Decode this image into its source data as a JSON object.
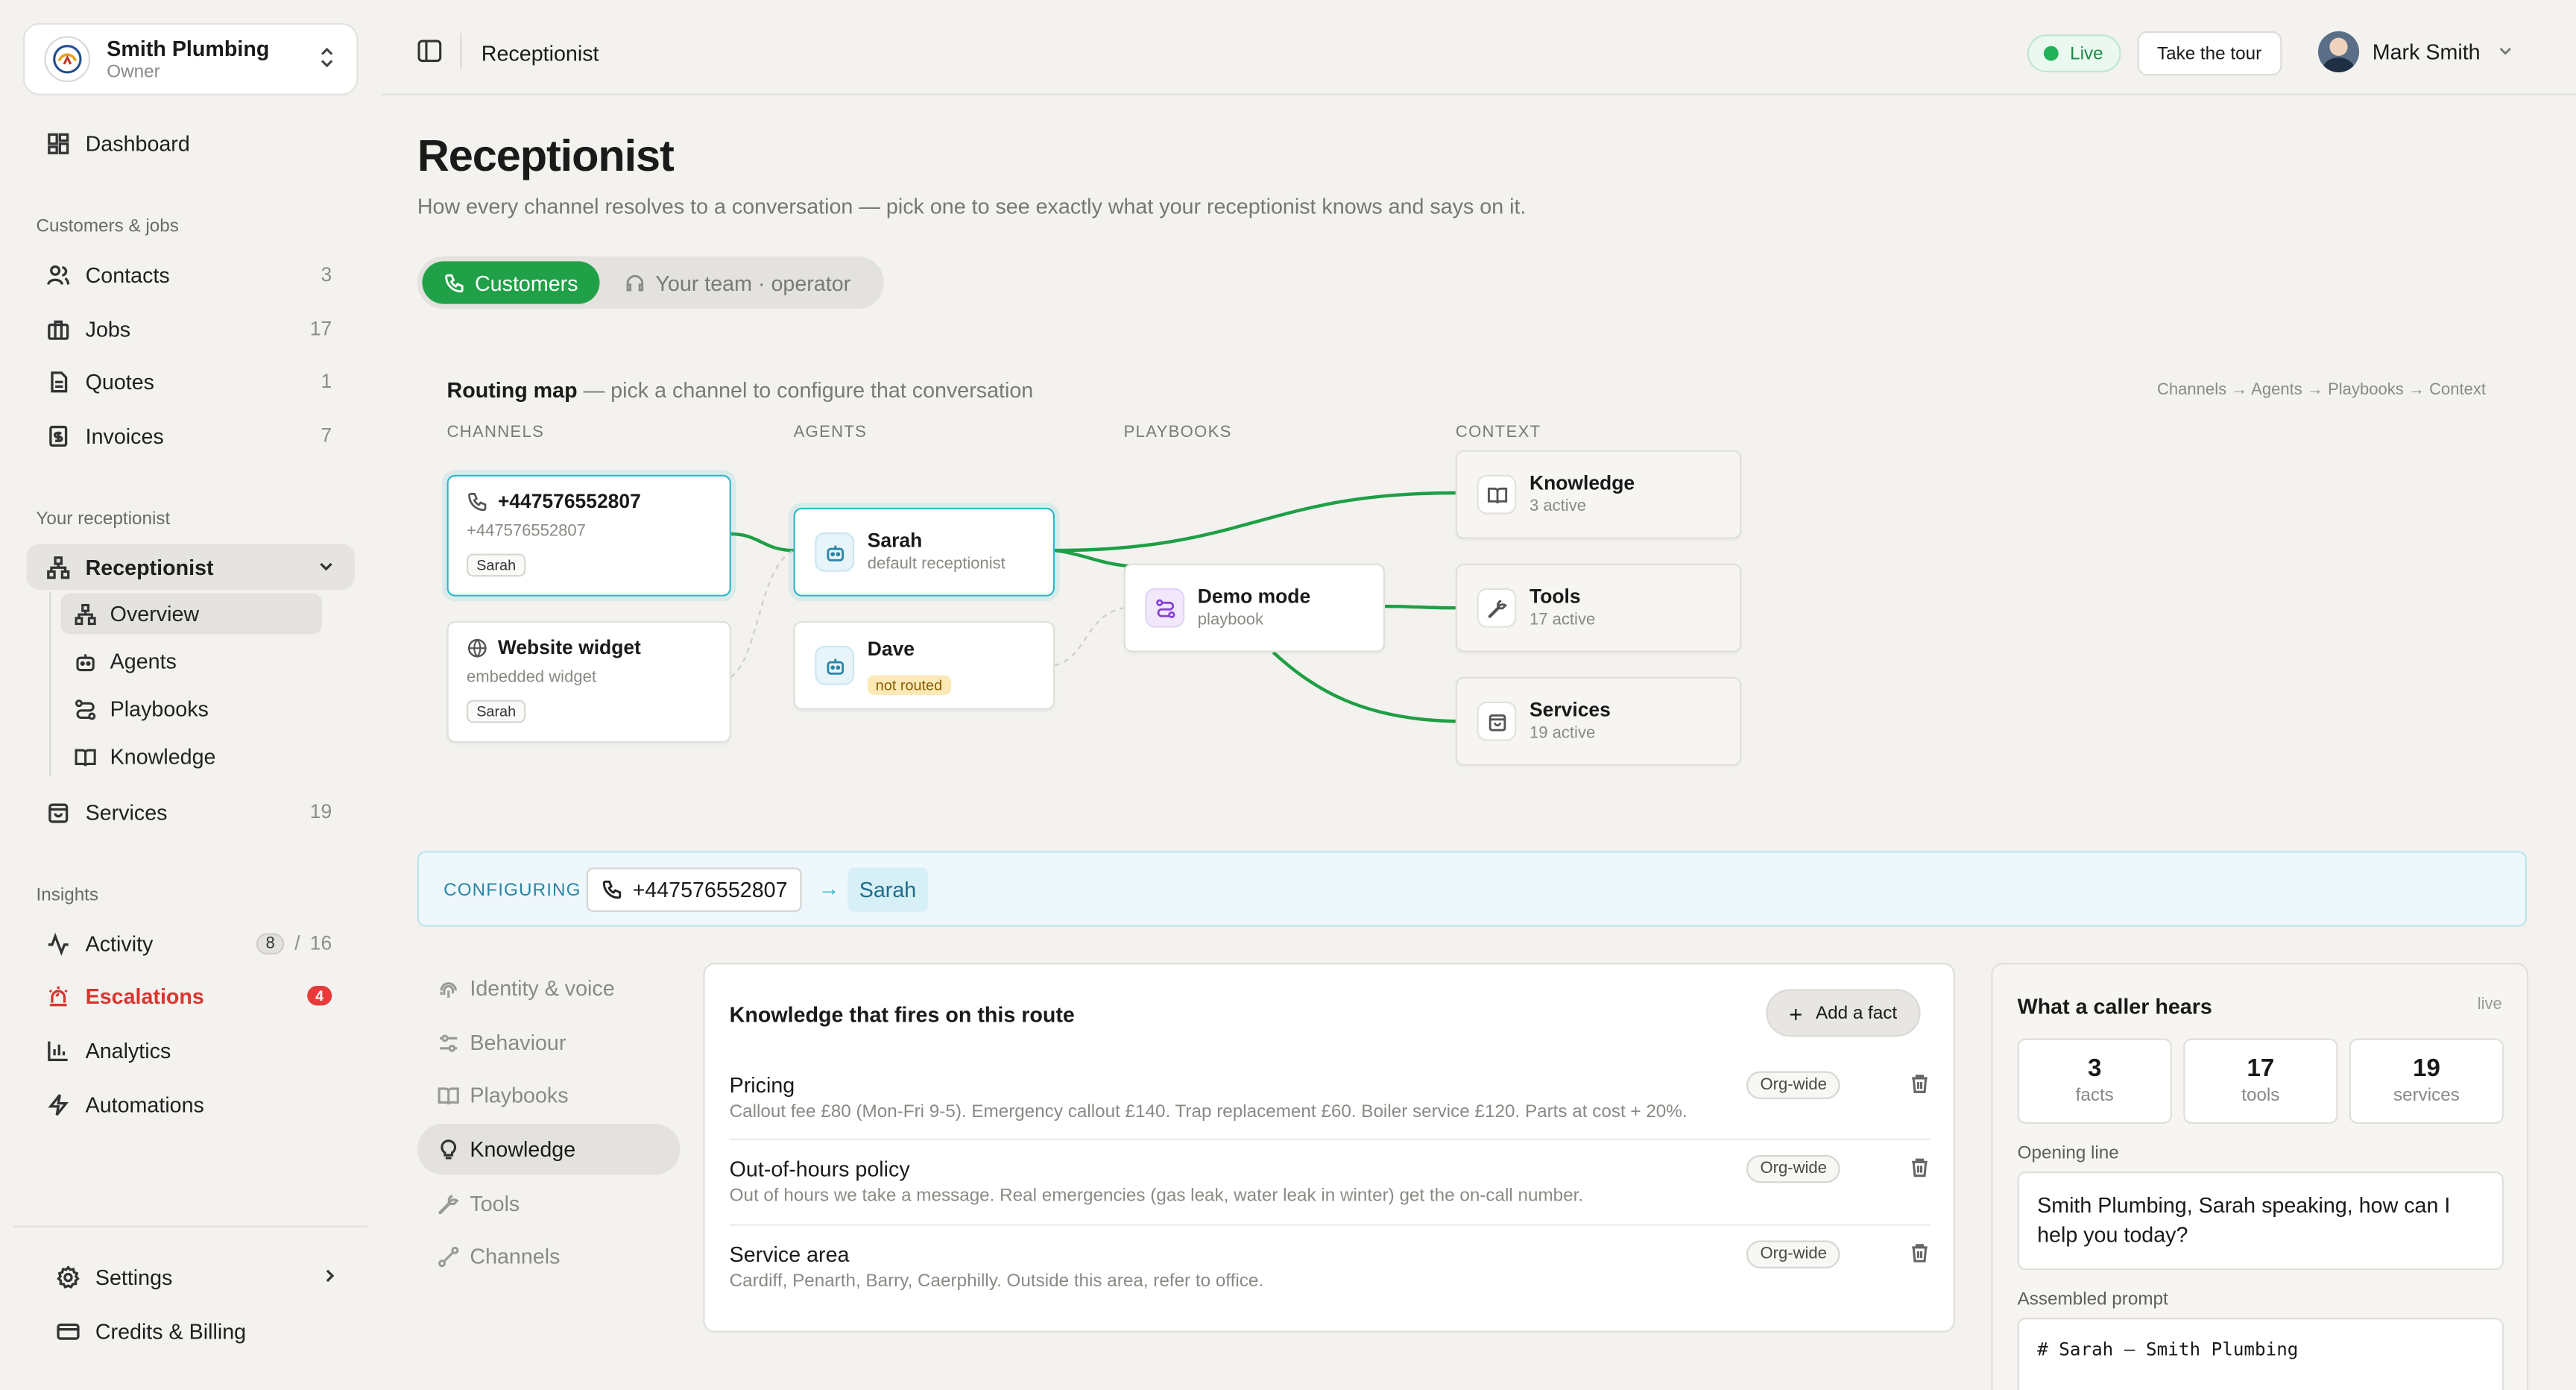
{
  "org": {
    "name": "Smith Plumbing",
    "role": "Owner"
  },
  "nav": {
    "dashboard": "Dashboard",
    "section_customers": "Customers & jobs",
    "contacts": {
      "label": "Contacts",
      "count": "3"
    },
    "jobs": {
      "label": "Jobs",
      "count": "17"
    },
    "quotes": {
      "label": "Quotes",
      "count": "1"
    },
    "invoices": {
      "label": "Invoices",
      "count": "7"
    },
    "section_receptionist": "Your receptionist",
    "receptionist": "Receptionist",
    "sub": {
      "overview": "Overview",
      "agents": "Agents",
      "playbooks": "Playbooks",
      "knowledge": "Knowledge"
    },
    "services": {
      "label": "Services",
      "count": "19"
    },
    "section_insights": "Insights",
    "activity": {
      "label": "Activity",
      "badge": "8",
      "sep": "/",
      "count": "16"
    },
    "escalations": {
      "label": "Escalations",
      "badge": "4"
    },
    "analytics": "Analytics",
    "automations": "Automations",
    "settings": "Settings",
    "billing": "Credits & Billing"
  },
  "topbar": {
    "breadcrumb": "Receptionist",
    "live": "Live",
    "tour": "Take the tour",
    "user": "Mark Smith"
  },
  "page": {
    "title": "Receptionist",
    "description": "How every channel resolves to a conversation — pick one to see exactly what your receptionist knows and says on it.",
    "tabs": {
      "customers": "Customers",
      "team": "Your team · operator"
    }
  },
  "map": {
    "title": "Routing map",
    "subtitle": " — pick a channel to configure that conversation",
    "legend": "Channels → Agents → Playbooks → Context",
    "columns": {
      "channels": "CHANNELS",
      "agents": "AGENTS",
      "playbooks": "PLAYBOOKS",
      "context": "CONTEXT"
    },
    "channels": [
      {
        "title": "+447576552807",
        "sub": "+447576552807",
        "chip": "Sarah"
      },
      {
        "title": "Website widget",
        "sub": "embedded widget",
        "chip": "Sarah"
      }
    ],
    "agents": [
      {
        "title": "Sarah",
        "sub": "default receptionist"
      },
      {
        "title": "Dave",
        "tag": "not routed"
      }
    ],
    "playbook": {
      "title": "Demo mode",
      "sub": "playbook"
    },
    "context": [
      {
        "title": "Knowledge",
        "sub": "3 active"
      },
      {
        "title": "Tools",
        "sub": "17 active"
      },
      {
        "title": "Services",
        "sub": "19 active"
      }
    ],
    "colors": {
      "route": "#1f9f45",
      "selected": "#2fb9c8"
    }
  },
  "configuring": {
    "label": "CONFIGURING",
    "phone": "+447576552807",
    "arrow": "→",
    "agent": "Sarah"
  },
  "config_nav": [
    "Identity & voice",
    "Behaviour",
    "Playbooks",
    "Knowledge",
    "Tools",
    "Channels"
  ],
  "knowledge": {
    "title": "Knowledge that fires on this route",
    "add": "Add a fact",
    "rows": [
      {
        "name": "Pricing",
        "scope": "Org-wide",
        "desc": "Callout fee £80 (Mon-Fri 9-5). Emergency callout £140. Trap replacement £60. Boiler service £120. Parts at cost + 20%."
      },
      {
        "name": "Out-of-hours policy",
        "scope": "Org-wide",
        "desc": "Out of hours we take a message. Real emergencies (gas leak, water leak in winter) get the on-call number."
      },
      {
        "name": "Service area",
        "scope": "Org-wide",
        "desc": "Cardiff, Penarth, Barry, Caerphilly. Outside this area, refer to office."
      }
    ]
  },
  "caller": {
    "title": "What a caller hears",
    "live": "live",
    "stats": [
      {
        "n": "3",
        "l": "facts"
      },
      {
        "n": "17",
        "l": "tools"
      },
      {
        "n": "19",
        "l": "services"
      }
    ],
    "opening_label": "Opening line",
    "opening": "Smith Plumbing, Sarah speaking, how can I help you today?",
    "prompt_label": "Assembled prompt",
    "prompt": "# Sarah — Smith Plumbing"
  }
}
